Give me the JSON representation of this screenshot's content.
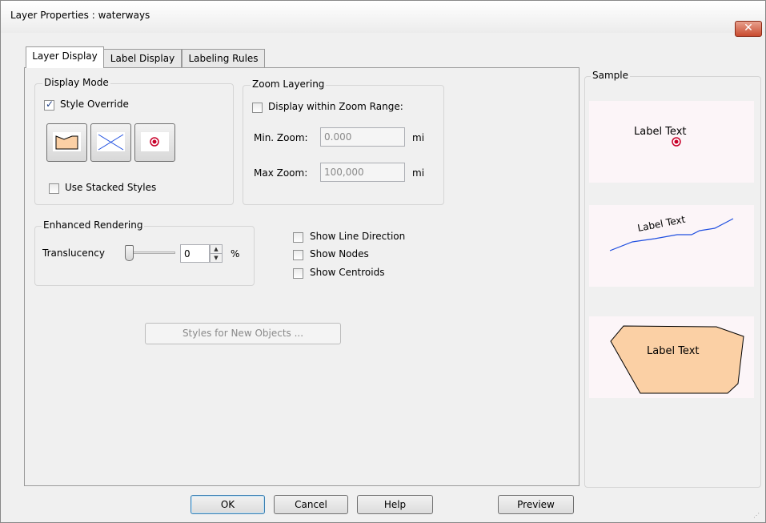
{
  "window": {
    "title": "Layer Properties  : waterways",
    "close_glyph": "✕"
  },
  "tabs": [
    {
      "label": "Layer Display",
      "active": true
    },
    {
      "label": "Label Display",
      "active": false
    },
    {
      "label": "Labeling Rules",
      "active": false
    }
  ],
  "display_mode": {
    "group_label": "Display Mode",
    "style_override_label": "Style Override",
    "style_override_checked": true,
    "style_buttons": [
      {
        "name": "area-style",
        "icon": "polygon-fill-icon"
      },
      {
        "name": "line-style",
        "icon": "line-cross-icon"
      },
      {
        "name": "point-style",
        "icon": "target-point-icon"
      }
    ],
    "use_stacked_label": "Use Stacked Styles",
    "use_stacked_checked": false
  },
  "zoom_layering": {
    "group_label": "Zoom Layering",
    "display_within_label": "Display within Zoom Range:",
    "display_within_checked": false,
    "min_label": "Min. Zoom:",
    "min_value": "0.000",
    "min_unit": "mi",
    "max_label": "Max Zoom:",
    "max_value": "100,000",
    "max_unit": "mi"
  },
  "enhanced_rendering": {
    "group_label": "Enhanced Rendering",
    "translucency_label": "Translucency",
    "translucency_value": "0",
    "translucency_unit": "%"
  },
  "options": {
    "show_line_direction": "Show Line Direction",
    "show_nodes": "Show Nodes",
    "show_centroids": "Show Centroids"
  },
  "styles_for_new_objects": "Styles for New Objects ...",
  "sample": {
    "group_label": "Sample",
    "point_label": "Label Text",
    "line_label": "Label Text",
    "area_label": "Label Text",
    "accent_color": "#c8002a",
    "line_color": "#1f4fe0",
    "area_fill": "#fbd0a5"
  },
  "buttons": {
    "ok": "OK",
    "cancel": "Cancel",
    "help": "Help",
    "preview": "Preview"
  }
}
